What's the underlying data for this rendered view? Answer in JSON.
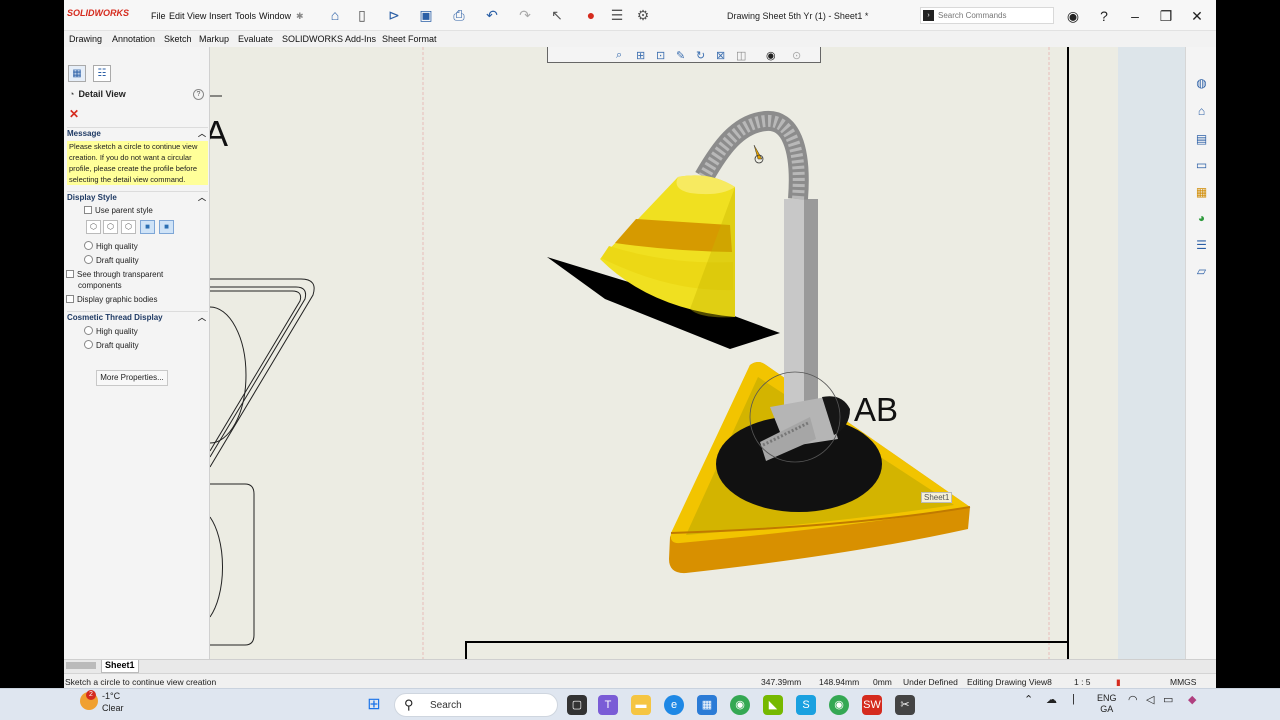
{
  "app": {
    "name": "SOLIDWORKS",
    "document_title": "Drawing Sheet 5th Yr (1) - Sheet1 *",
    "menus": [
      "File",
      "Edit",
      "View",
      "Insert",
      "Tools",
      "Window"
    ],
    "search_placeholder": "Search Commands"
  },
  "command_tabs": [
    "Drawing",
    "Annotation",
    "Sketch",
    "Markup",
    "Evaluate",
    "SOLIDWORKS Add-Ins",
    "Sheet Format"
  ],
  "property_manager": {
    "title": "Detail View",
    "message_header": "Message",
    "message_lines": [
      "Please sketch a circle to continue view",
      "creation. If you do not want a circular",
      "profile, please create the profile before",
      "selecting the detail view command."
    ],
    "display_style_header": "Display Style",
    "use_parent_style": "Use parent style",
    "high_quality": "High quality",
    "draft_quality": "Draft quality",
    "see_through_line1": "See through transparent",
    "see_through_line2": "components",
    "display_graphic_bodies": "Display graphic bodies",
    "cosmetic_thread_header": "Cosmetic Thread Display",
    "ct_high_quality": "High quality",
    "ct_draft_quality": "Draft quality",
    "more_properties": "More Properties..."
  },
  "canvas": {
    "detail_label": "AB",
    "partial_label": "A",
    "sheet_tag": "Sheet1"
  },
  "sheet_tab": "Sheet1",
  "status_bar": {
    "prompt": "Sketch a circle to continue view creation",
    "x": "347.39mm",
    "y": "148.94mm",
    "z": "0mm",
    "state": "Under Defined",
    "editing": "Editing Drawing View8",
    "scale": "1 : 5",
    "units": "MMGS"
  },
  "taskbar": {
    "temperature": "-1°C",
    "weather": "Clear",
    "search": "Search",
    "lang1": "ENG",
    "lang2": "GA",
    "badge": "2"
  },
  "colors": {
    "sw_red": "#d52b1e",
    "message_yellow": "#ffff99",
    "canvas_bg": "#ecece3"
  }
}
